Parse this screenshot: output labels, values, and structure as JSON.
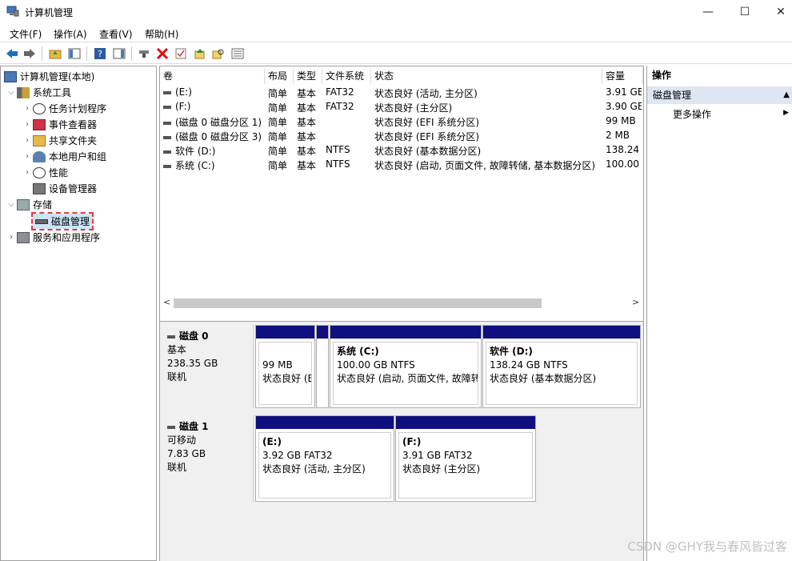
{
  "window": {
    "title": "计算机管理",
    "minimize": "—",
    "maximize": "☐",
    "close": "✕"
  },
  "menu": [
    "文件(F)",
    "操作(A)",
    "查看(V)",
    "帮助(H)"
  ],
  "tree": {
    "root": "计算机管理(本地)",
    "system_tools": "系统工具",
    "task_scheduler": "任务计划程序",
    "event_viewer": "事件查看器",
    "shared_folders": "共享文件夹",
    "local_users": "本地用户和组",
    "performance": "性能",
    "device_manager": "设备管理器",
    "storage": "存储",
    "disk_management": "磁盘管理",
    "services_apps": "服务和应用程序"
  },
  "volume_table": {
    "headers": [
      "卷",
      "布局",
      "类型",
      "文件系统",
      "状态",
      "容量"
    ],
    "rows": [
      [
        "(E:)",
        "简单",
        "基本",
        "FAT32",
        "状态良好 (活动, 主分区)",
        "3.91 GE"
      ],
      [
        "(F:)",
        "简单",
        "基本",
        "FAT32",
        "状态良好 (主分区)",
        "3.90 GE"
      ],
      [
        "(磁盘 0 磁盘分区 1)",
        "简单",
        "基本",
        "",
        "状态良好 (EFI 系统分区)",
        "99 MB"
      ],
      [
        "(磁盘 0 磁盘分区 3)",
        "简单",
        "基本",
        "",
        "状态良好 (EFI 系统分区)",
        "2 MB"
      ],
      [
        "软件 (D:)",
        "简单",
        "基本",
        "NTFS",
        "状态良好 (基本数据分区)",
        "138.24"
      ],
      [
        "系统 (C:)",
        "简单",
        "基本",
        "NTFS",
        "状态良好 (启动, 页面文件, 故障转储, 基本数据分区)",
        "100.00"
      ]
    ]
  },
  "disk0": {
    "name": "磁盘 0",
    "type": "基本",
    "size": "238.35 GB",
    "status": "联机",
    "p1": {
      "size": "99 MB",
      "status": "状态良好 (E"
    },
    "c": {
      "name": "系统 (C:)",
      "size": "100.00 GB NTFS",
      "status": "状态良好 (启动, 页面文件, 故障转"
    },
    "d": {
      "name": "软件 (D:)",
      "size": "138.24 GB NTFS",
      "status": "状态良好 (基本数据分区)"
    }
  },
  "disk1": {
    "name": "磁盘 1",
    "type": "可移动",
    "size": "7.83 GB",
    "status": "联机",
    "e": {
      "name": "(E:)",
      "size": "3.92 GB FAT32",
      "status": "状态良好 (活动, 主分区)"
    },
    "f": {
      "name": "(F:)",
      "size": "3.91 GB FAT32",
      "status": "状态良好 (主分区)"
    }
  },
  "actions": {
    "header": "操作",
    "section": "磁盘管理",
    "more": "更多操作"
  },
  "watermark": "CSDN @GHY我与春风皆过客",
  "colors": {
    "partition_bar": "#0f0f7f",
    "selection_outline": "#e53935"
  }
}
